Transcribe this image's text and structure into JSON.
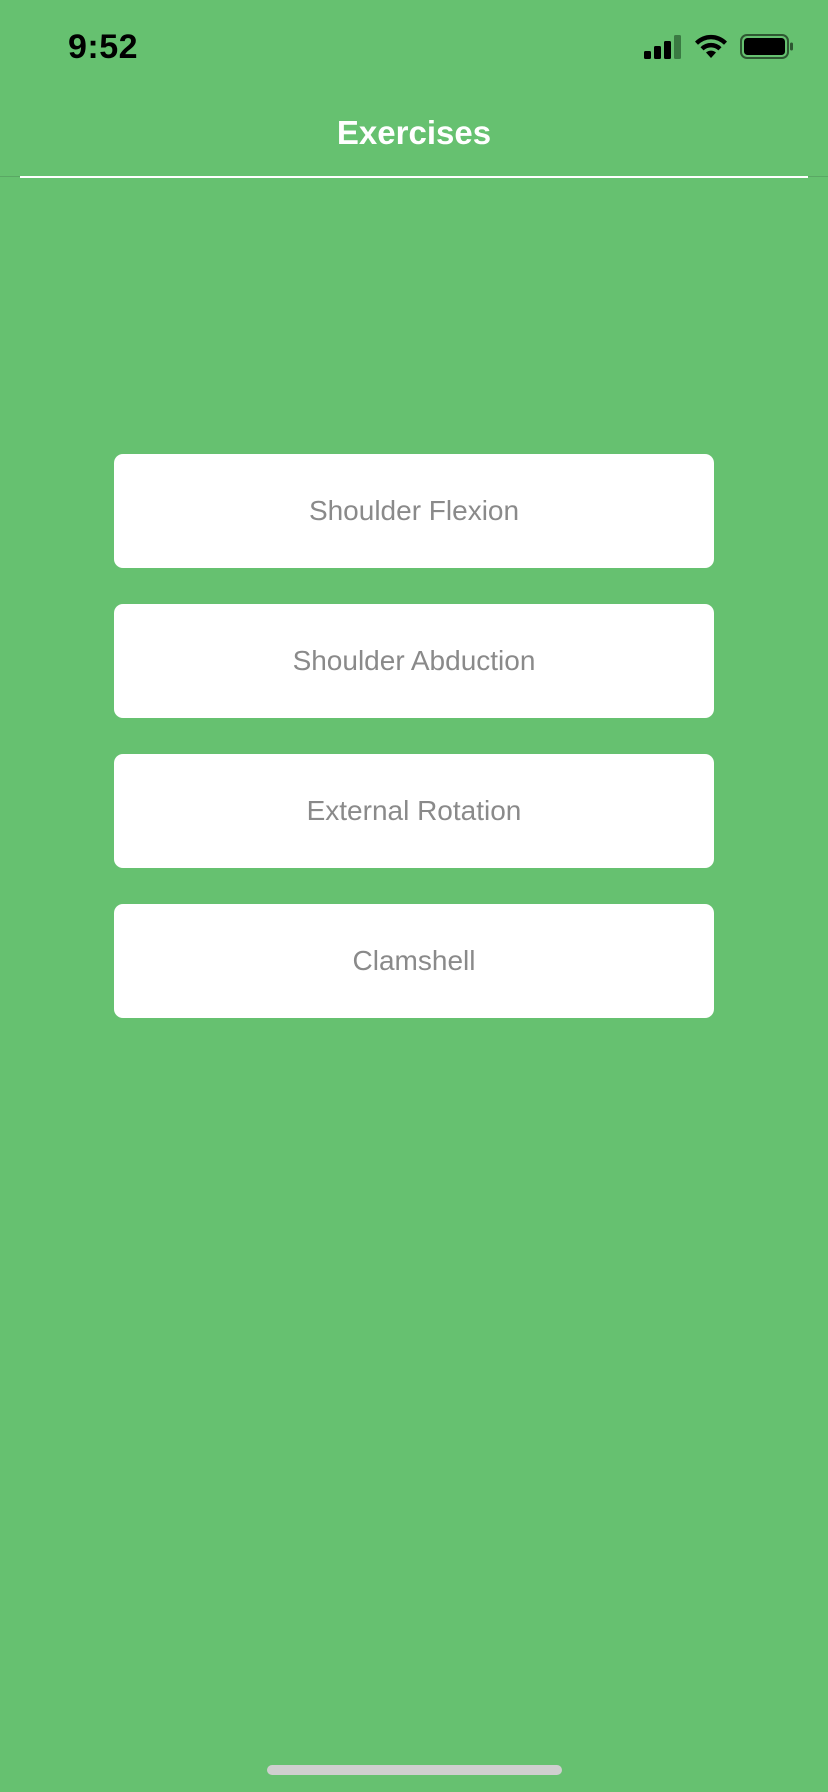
{
  "status_bar": {
    "time": "9:52",
    "signal_icon": "cellular-signal-icon",
    "wifi_icon": "wifi-icon",
    "battery_icon": "battery-icon"
  },
  "nav": {
    "title": "Exercises"
  },
  "exercises": [
    {
      "label": "Shoulder Flexion"
    },
    {
      "label": "Shoulder Abduction"
    },
    {
      "label": "External Rotation"
    },
    {
      "label": "Clamshell"
    }
  ],
  "colors": {
    "background": "#66c170",
    "button_background": "#ffffff",
    "button_text": "#8a8a8a",
    "title_text": "#ffffff"
  }
}
